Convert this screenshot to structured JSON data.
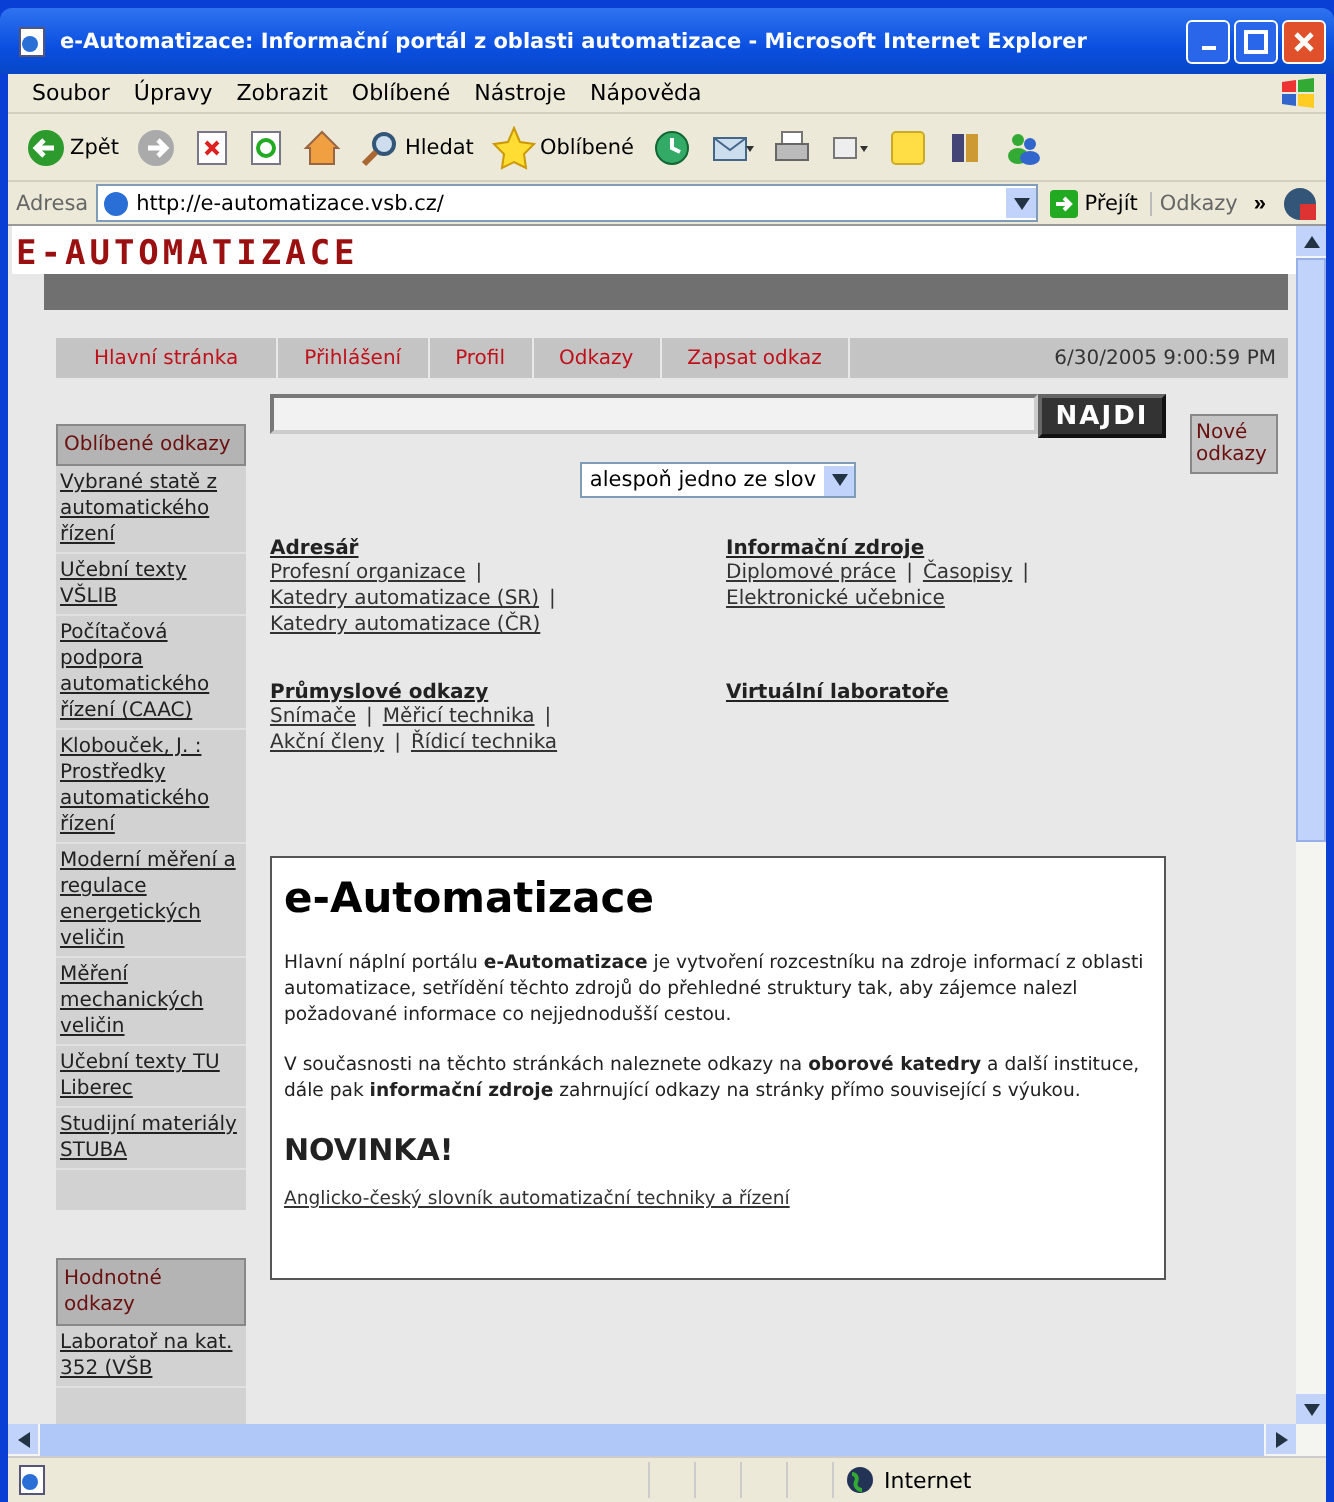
{
  "window": {
    "title": "e-Automatizace: Informační portál z oblasti automatizace - Microsoft Internet Explorer"
  },
  "menu": [
    "Soubor",
    "Úpravy",
    "Zobrazit",
    "Oblíbené",
    "Nástroje",
    "Nápověda"
  ],
  "toolbar": [
    {
      "kind": "back",
      "label": "Zpět"
    },
    {
      "kind": "forward"
    },
    {
      "kind": "stop"
    },
    {
      "kind": "refresh"
    },
    {
      "kind": "home"
    },
    {
      "kind": "search",
      "label": "Hledat"
    },
    {
      "kind": "favorites",
      "label": "Oblíbené"
    },
    {
      "kind": "history"
    },
    {
      "kind": "mail"
    },
    {
      "kind": "print"
    },
    {
      "kind": "edit"
    },
    {
      "kind": "note"
    },
    {
      "kind": "research"
    },
    {
      "kind": "messenger"
    }
  ],
  "address": {
    "label": "Adresa",
    "url": "http://e-automatizace.vsb.cz/",
    "go": "Přejít",
    "links": "Odkazy",
    "more": "»"
  },
  "page": {
    "logo": "E-AUTOMATIZACE",
    "nav": [
      "Hlavní stránka",
      "Přihlášení",
      "Profil",
      "Odkazy",
      "Zapsat odkaz"
    ],
    "date": "6/30/2005 9:00:59 PM",
    "search": {
      "button": "NAJDI",
      "mode": "alespoň jedno ze slov"
    },
    "sidebar": [
      {
        "title": "Oblíbené odkazy",
        "items": [
          "Vybrané statě z automatického řízení",
          "Učební texty VŠLIB",
          "Počítačová podpora automatického řízení (CAAC)",
          "Klobouček, J. : Prostředky automatického řízení",
          "Moderní měření a regulace energetických veličin",
          "Měření mechanických veličin",
          "Učební texty TU Liberec",
          "Studijní materiály STUBA"
        ]
      },
      {
        "title": "Hodnotné odkazy",
        "items": [
          "Laboratoř na kat. 352 (VŠB"
        ]
      }
    ],
    "new_links": "Nové odkazy",
    "separator": "|",
    "categories": [
      {
        "title": "Adresář",
        "links": [
          "Profesní organizace",
          "Katedry automatizace (SR)",
          "Katedry automatizace (ČR)"
        ]
      },
      {
        "title": "Informační zdroje",
        "links": [
          "Diplomové práce",
          "Časopisy",
          "Elektronické učebnice"
        ]
      },
      {
        "title": "Průmyslové odkazy",
        "links": [
          "Snímače",
          "Měřicí technika",
          "Akční členy",
          "Řídicí technika"
        ]
      },
      {
        "title": "Virtuální laboratoře"
      }
    ],
    "article": {
      "heading": "e-Automatizace",
      "paragraphs": [
        "Hlavní náplní portálu **e-Automatizace** je vytvoření rozcestníku na zdroje informací z oblasti automatizace, setřídění těchto zdrojů do přehledné struktury tak, aby zájemce nalezl požadované informace co nejjednodušší cestou.",
        "V současnosti na těchto stránkách naleznete odkazy na **oborové katedry** a další instituce, dále pak **informační zdroje** zahrnující odkazy na stránky přímo související s výukou."
      ],
      "news_heading": "NOVINKA!",
      "news_link": "Anglicko-český slovník automatizační techniky a řízení"
    }
  },
  "status": {
    "zone": "Internet"
  }
}
